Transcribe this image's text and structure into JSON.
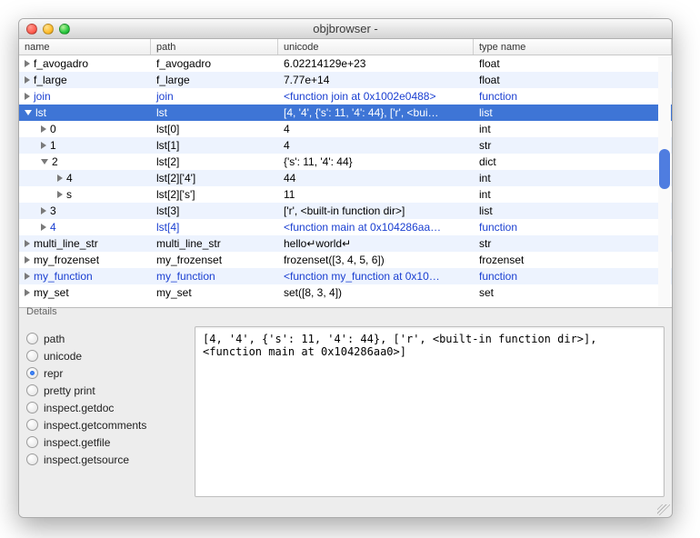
{
  "window": {
    "title": "objbrowser -"
  },
  "columns": {
    "name": "name",
    "path": "path",
    "unicode": "unicode",
    "type": "type name"
  },
  "rows": [
    {
      "indent": 0,
      "expand": "closed",
      "name": "f_avogadro",
      "path": "f_avogadro",
      "unicode": "6.02214129e+23",
      "type": "float",
      "alt": false,
      "func": false
    },
    {
      "indent": 0,
      "expand": "closed",
      "name": "f_large",
      "path": "f_large",
      "unicode": "7.77e+14",
      "type": "float",
      "alt": true,
      "func": false
    },
    {
      "indent": 0,
      "expand": "closed",
      "name": "join",
      "path": "join",
      "unicode": "<function join at 0x1002e0488>",
      "type": "function",
      "alt": false,
      "func": true
    },
    {
      "indent": 0,
      "expand": "open",
      "name": "lst",
      "path": "lst",
      "unicode": "[4, '4', {'s': 11, '4': 44}, ['r', <bui…",
      "type": "list",
      "alt": false,
      "sel": true,
      "func": false
    },
    {
      "indent": 1,
      "expand": "closed",
      "name": "0",
      "path": "lst[0]",
      "unicode": "4",
      "type": "int",
      "alt": false,
      "func": false
    },
    {
      "indent": 1,
      "expand": "closed",
      "name": "1",
      "path": "lst[1]",
      "unicode": "4",
      "type": "str",
      "alt": true,
      "func": false
    },
    {
      "indent": 1,
      "expand": "open",
      "name": "2",
      "path": "lst[2]",
      "unicode": "{'s': 11, '4': 44}",
      "type": "dict",
      "alt": false,
      "func": false
    },
    {
      "indent": 2,
      "expand": "closed",
      "name": "4",
      "path": "lst[2]['4']",
      "unicode": "44",
      "type": "int",
      "alt": true,
      "func": false
    },
    {
      "indent": 2,
      "expand": "closed",
      "name": "s",
      "path": "lst[2]['s']",
      "unicode": "11",
      "type": "int",
      "alt": false,
      "func": false
    },
    {
      "indent": 1,
      "expand": "closed",
      "name": "3",
      "path": "lst[3]",
      "unicode": "['r', <built-in function dir>]",
      "type": "list",
      "alt": true,
      "func": false
    },
    {
      "indent": 1,
      "expand": "closed",
      "name": "4",
      "path": "lst[4]",
      "unicode": "<function main at 0x104286aa…",
      "unicode_trunc": "t…",
      "type": "function",
      "alt": false,
      "func": true
    },
    {
      "indent": 0,
      "expand": "closed",
      "name": "multi_line_str",
      "path": "multi_line_str",
      "unicode": "hello↵world↵",
      "type": "str",
      "alt": true,
      "func": false
    },
    {
      "indent": 0,
      "expand": "closed",
      "name": "my_frozenset",
      "path": "my_frozenset",
      "unicode": "frozenset([3, 4, 5, 6])",
      "type": "frozenset",
      "alt": false,
      "func": false
    },
    {
      "indent": 0,
      "expand": "closed",
      "name": "my_function",
      "path": "my_function",
      "unicode": "<function my_function at 0x10…",
      "type": "function",
      "alt": true,
      "func": true
    },
    {
      "indent": 0,
      "expand": "closed",
      "name": "my_set",
      "path": "my_set",
      "unicode": "set([8, 3, 4])",
      "type": "set",
      "alt": false,
      "func": false
    }
  ],
  "details": {
    "label": "Details",
    "radios": [
      {
        "label": "path",
        "checked": false
      },
      {
        "label": "unicode",
        "checked": false
      },
      {
        "label": "repr",
        "checked": true
      },
      {
        "label": "pretty print",
        "checked": false
      },
      {
        "label": "inspect.getdoc",
        "checked": false
      },
      {
        "label": "inspect.getcomments",
        "checked": false
      },
      {
        "label": "inspect.getfile",
        "checked": false
      },
      {
        "label": "inspect.getsource",
        "checked": false
      }
    ],
    "text": "[4, '4', {'s': 11, '4': 44}, ['r', <built-in function dir>], <function main at 0x104286aa0>]"
  }
}
